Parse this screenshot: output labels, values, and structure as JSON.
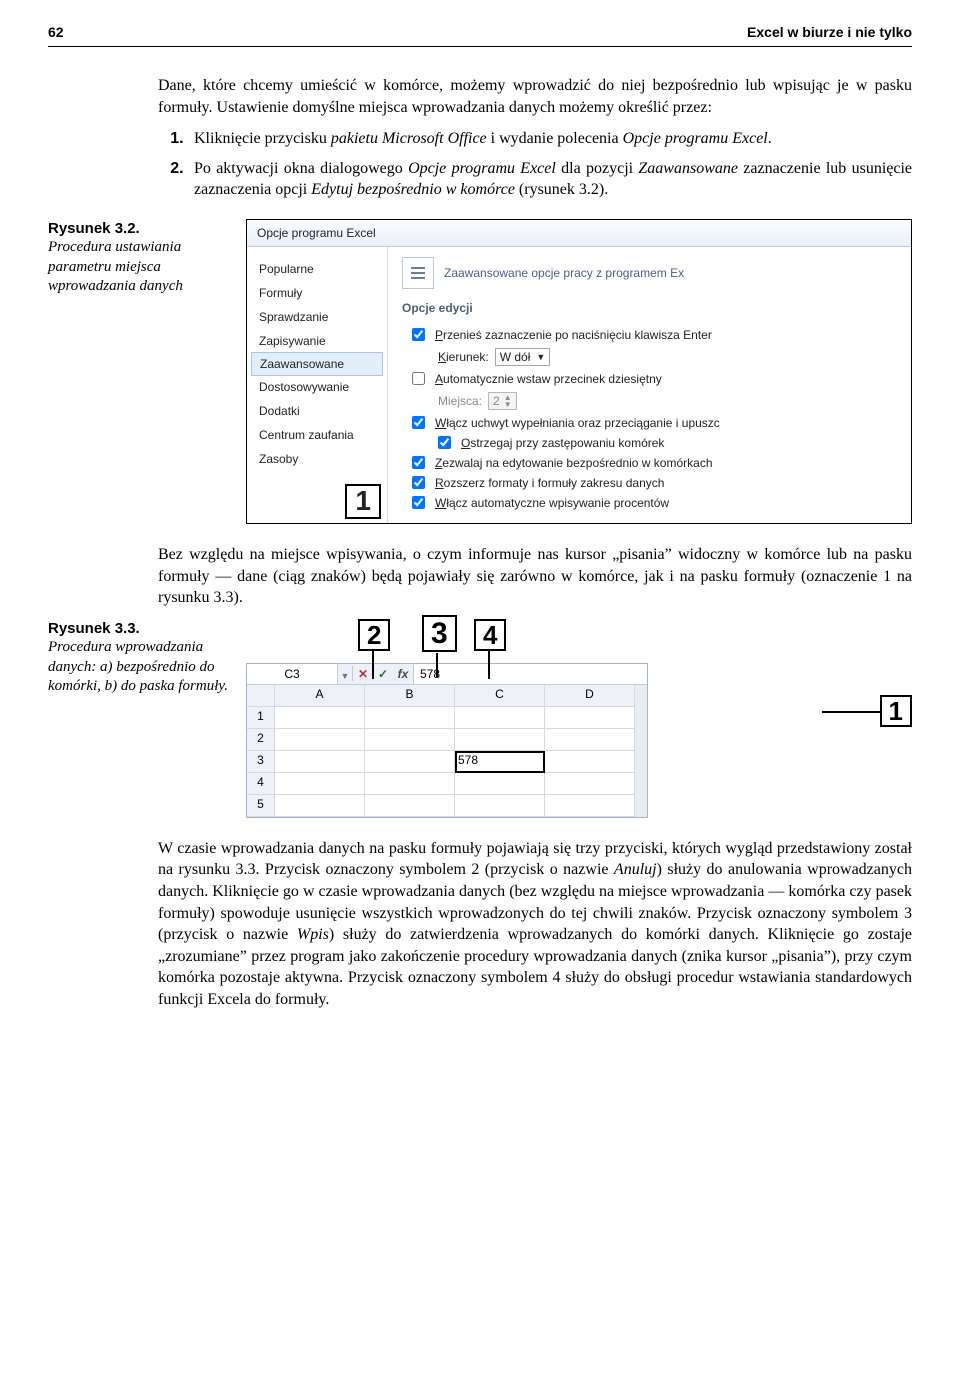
{
  "header": {
    "page_number": "62",
    "book_title": "Excel w biurze i nie tylko"
  },
  "para_intro": "Dane, które chcemy umieścić w komórce, możemy wprowadzić do niej bezpośrednio lub wpisując je w pasku formuły. Ustawienie domyślne miejsca wprowadzania danych możemy określić przez:",
  "steps_a": [
    {
      "pre": "Kliknięcie przycisku ",
      "it1": "pakietu Microsoft Office",
      "mid": " i wydanie polecenia ",
      "it2": "Opcje programu Excel",
      "post": "."
    },
    {
      "pre": "Po aktywacji okna dialogowego ",
      "it1": "Opcje programu Excel",
      "mid1": " dla pozycji ",
      "it2": "Zaawansowane",
      "mid2": " zaznaczenie lub usunięcie zaznaczenia opcji ",
      "it3": "Edytuj bezpośrednio w komórce",
      "post": " (rysunek 3.2)."
    }
  ],
  "fig32": {
    "label": "Rysunek 3.2.",
    "desc": "Procedura ustawiania parametru miejsca wprowadzania danych",
    "callout1": "1",
    "dialog": {
      "title": "Opcje programu Excel",
      "nav": [
        "Popularne",
        "Formuły",
        "Sprawdzanie",
        "Zapisywanie",
        "Zaawansowane",
        "Dostosowywanie",
        "Dodatki",
        "Centrum zaufania",
        "Zasoby"
      ],
      "header_text": "Zaawansowane opcje pracy z programem Ex",
      "section_title": "Opcje edycji",
      "opts": {
        "o1": "Przenieś zaznaczenie po naciśnięciu klawisza Enter",
        "dir_lbl": "Kierunek:",
        "dir_val": "W dół",
        "o2": "Automatycznie wstaw przecinek dziesiętny",
        "places_lbl": "Miejsca:",
        "places_val": "2",
        "o3": "Włącz uchwyt wypełniania oraz przeciąganie i upuszc",
        "o4": "Ostrzegaj przy zastępowaniu komórek",
        "o5": "Zezwalaj na edytowanie bezpośrednio w komórkach",
        "o6": "Rozszerz formaty i formuły zakresu danych",
        "o7": "Włącz automatyczne wpisywanie procentów"
      }
    }
  },
  "para_mid": "Bez względu na miejsce wpisywania, o czym informuje nas kursor „pisania” widoczny w komórce lub na pasku formuły — dane (ciąg znaków) będą pojawiały się zarówno w komórce, jak i na pasku formuły (oznaczenie 1 na rysunku 3.3).",
  "fig33": {
    "label": "Rysunek 3.3.",
    "desc": "Procedura wprowadzania danych: a) bezpośrednio do komórki, b) do paska formuły.",
    "labels": {
      "c1": "1",
      "c2": "2",
      "c3": "3",
      "c4": "4"
    },
    "formula_bar": {
      "name_box": "C3",
      "cancel": "✕",
      "ok": "✓",
      "fx": "fx",
      "value": "578"
    },
    "grid": {
      "cols": [
        "A",
        "B",
        "C",
        "D"
      ],
      "rows": [
        "1",
        "2",
        "3",
        "4",
        "5"
      ],
      "cell_c3": "578"
    }
  },
  "para_end": {
    "t1": "W czasie wprowadzania danych na pasku formuły pojawiają się trzy przyciski, których wygląd przedstawiony został na rysunku 3.3. Przycisk oznaczony symbolem 2 (przycisk o nazwie ",
    "it1": "Anuluj",
    "t2": ") służy do anulowania wprowadzanych danych. Kliknięcie go w czasie wprowadzania danych (bez względu na miejsce wprowadzania — komórka czy pasek formuły) spowoduje usunięcie wszystkich wprowadzonych do tej chwili znaków. Przycisk oznaczony symbolem 3 (przycisk o nazwie ",
    "it2": "Wpis",
    "t3": ") służy do zatwierdzenia wprowadzanych do komórki danych. Kliknięcie go zostaje „zrozumiane” przez program jako zakończenie procedury wprowadzania danych (znika kursor „pisania”), przy czym komórka pozostaje aktywna. Przycisk oznaczony symbolem 4 służy do obsługi procedur wstawiania standardowych funkcji Excela do formuły."
  }
}
